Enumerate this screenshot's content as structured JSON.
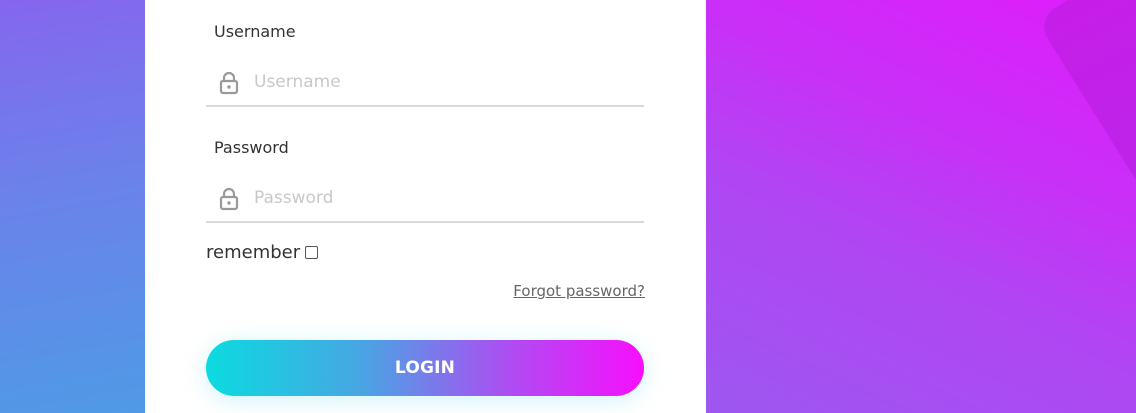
{
  "form": {
    "username": {
      "label": "Username",
      "placeholder": "Username",
      "value": "",
      "icon": "lock-icon"
    },
    "password": {
      "label": "Password",
      "placeholder": "Password",
      "value": "",
      "icon": "lock-icon"
    },
    "remember": {
      "label": "remember",
      "checked": false
    },
    "forgot_label": "Forgot password?",
    "login_label": "LOGIN"
  },
  "colors": {
    "gradient_start": "#0bdbe0",
    "gradient_end": "#f70ffd",
    "background_left": "#6b82ea",
    "background_right": "#d01ffa"
  }
}
